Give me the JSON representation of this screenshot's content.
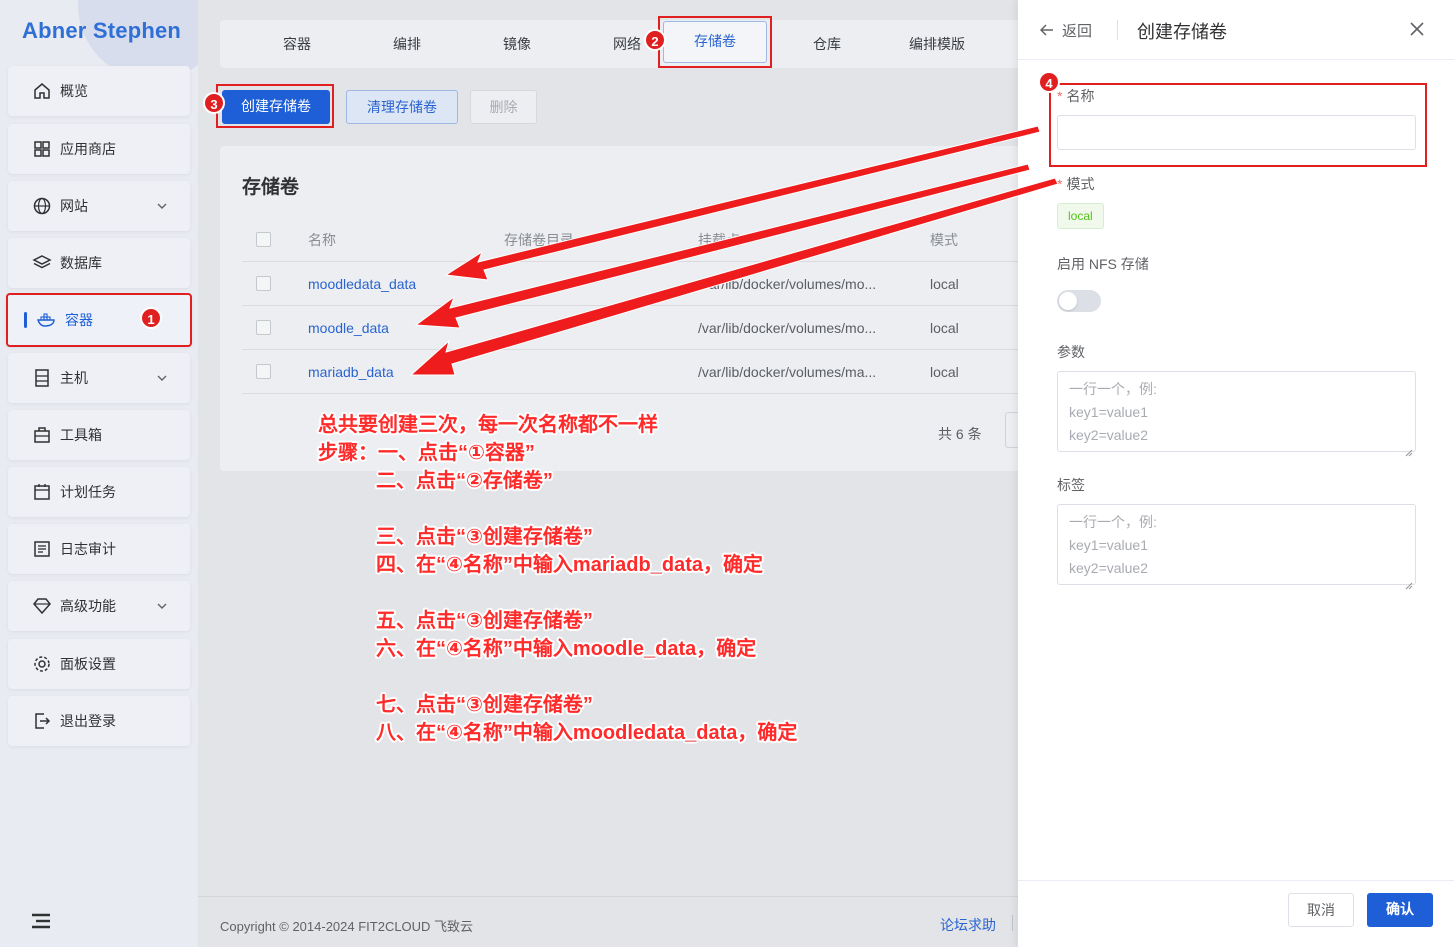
{
  "brand": "Abner Stephen",
  "sidebar": {
    "items": [
      {
        "label": "概览",
        "icon": "home-icon"
      },
      {
        "label": "应用商店",
        "icon": "grid-icon"
      },
      {
        "label": "网站",
        "icon": "globe-icon"
      },
      {
        "label": "数据库",
        "icon": "layers-icon"
      },
      {
        "label": "容器",
        "icon": "docker-icon"
      },
      {
        "label": "主机",
        "icon": "server-icon"
      },
      {
        "label": "工具箱",
        "icon": "toolbox-icon"
      },
      {
        "label": "计划任务",
        "icon": "calendar-icon"
      },
      {
        "label": "日志审计",
        "icon": "log-icon"
      },
      {
        "label": "高级功能",
        "icon": "diamond-icon"
      },
      {
        "label": "面板设置",
        "icon": "gear-icon"
      },
      {
        "label": "退出登录",
        "icon": "logout-icon"
      }
    ]
  },
  "tabs": [
    "容器",
    "编排",
    "镜像",
    "网络",
    "存储卷",
    "仓库",
    "编排模版"
  ],
  "actions": {
    "create": "创建存储卷",
    "prune": "清理存储卷",
    "delete": "删除"
  },
  "card": {
    "title": "存储卷",
    "columns": [
      "名称",
      "存储卷目录",
      "挂载点",
      "模式"
    ],
    "rows": [
      {
        "name": "moodledata_data",
        "mount": "/var/lib/docker/volumes/mo...",
        "mode": "local"
      },
      {
        "name": "moodle_data",
        "mount": "/var/lib/docker/volumes/mo...",
        "mode": "local"
      },
      {
        "name": "mariadb_data",
        "mount": "/var/lib/docker/volumes/ma...",
        "mode": "local"
      }
    ],
    "total": "共 6 条"
  },
  "badges": [
    "1",
    "2",
    "3",
    "4"
  ],
  "annotation": [
    "总共要创建三次，每一次名称都不一样",
    "步骤：一、点击“①容器”",
    "二、点击“②存储卷”",
    "三、点击“③创建存储卷”",
    "四、在“④名称”中输入mariadb_data，确定",
    "五、点击“③创建存储卷”",
    "六、在“④名称”中输入moodle_data，确定",
    "七、点击“③创建存储卷”",
    "八、在“④名称”中输入moodledata_data，确定"
  ],
  "footer": {
    "copyright": "Copyright © 2014-2024 FIT2CLOUD 飞致云",
    "forum": "论坛求助"
  },
  "drawer": {
    "back": "返回",
    "title": "创建存储卷",
    "name_label": "名称",
    "name_value": "",
    "mode_label": "模式",
    "mode_value": "local",
    "nfs_label": "启用 NFS 存储",
    "nfs_enabled": false,
    "params_label": "参数",
    "params_placeholder": "一行一个，例:\nkey1=value1\nkey2=value2",
    "labels_label": "标签",
    "labels_placeholder": "一行一个，例:\nkey1=value1\nkey2=value2",
    "cancel": "取消",
    "confirm": "确认"
  },
  "colors": {
    "primary": "#1e5ed6",
    "annotation_red": "#e02020",
    "tag_green": "#52c41a"
  }
}
